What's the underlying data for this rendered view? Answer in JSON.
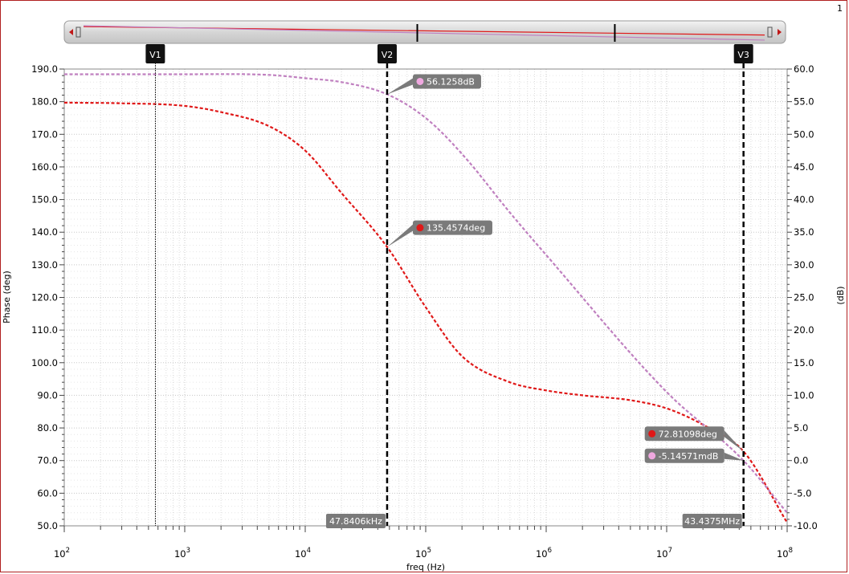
{
  "page_number": "1",
  "chart_data": {
    "type": "line",
    "xlabel": "freq (Hz)",
    "ylabel_left": "Phase (deg)",
    "ylabel_right": "(dB)",
    "x_scale": "log",
    "xlim": [
      100,
      100000000
    ],
    "x_ticks": [
      {
        "value": 100,
        "base": "10",
        "exp": "2"
      },
      {
        "value": 1000,
        "base": "10",
        "exp": "3"
      },
      {
        "value": 10000,
        "base": "10",
        "exp": "4"
      },
      {
        "value": 100000,
        "base": "10",
        "exp": "5"
      },
      {
        "value": 1000000,
        "base": "10",
        "exp": "6"
      },
      {
        "value": 10000000,
        "base": "10",
        "exp": "7"
      },
      {
        "value": 100000000,
        "base": "10",
        "exp": "8"
      }
    ],
    "ylim_left": [
      50,
      190
    ],
    "y_ticks_left": [
      "50.0",
      "60.0",
      "70.0",
      "80.0",
      "90.0",
      "100.0",
      "110.0",
      "120.0",
      "130.0",
      "140.0",
      "150.0",
      "160.0",
      "170.0",
      "180.0",
      "190.0"
    ],
    "ylim_right": [
      -10,
      60
    ],
    "y_ticks_right": [
      "-10.0",
      "-5.0",
      "0.0",
      "5.0",
      "10.0",
      "15.0",
      "20.0",
      "25.0",
      "30.0",
      "35.0",
      "40.0",
      "45.0",
      "50.0",
      "55.0",
      "60.0"
    ],
    "grid": true,
    "series": [
      {
        "axis": "left",
        "color": "#e01818",
        "x": [
          100,
          300,
          1000,
          2000,
          5000,
          10000,
          20000,
          47840,
          100000,
          200000,
          500000,
          1000000,
          2000000,
          5000000,
          10000000,
          20000000,
          43440000,
          100000000
        ],
        "y": [
          179.7,
          179.5,
          178.7,
          176.8,
          172.5,
          165.0,
          152.0,
          135.46,
          117.0,
          102.0,
          94.0,
          91.5,
          90.0,
          88.5,
          86.0,
          81.0,
          72.81,
          51.0
        ]
      },
      {
        "axis": "right",
        "color": "#c080c0",
        "x": [
          100,
          1000,
          5000,
          10000,
          20000,
          47840,
          100000,
          200000,
          500000,
          1000000,
          10000000,
          43440000,
          100000000
        ],
        "y": [
          59.2,
          59.2,
          59.1,
          58.6,
          58.0,
          56.13,
          52.5,
          47.0,
          38.0,
          31.5,
          10.5,
          -0.005,
          -8.0
        ]
      }
    ],
    "vertical_markers": [
      {
        "label": "V1",
        "x": 570,
        "style": "thin"
      },
      {
        "label": "V2",
        "x": 47840,
        "style": "bold",
        "readout": "47.8406kHz"
      },
      {
        "label": "V3",
        "x": 43440000,
        "style": "bold",
        "readout": "43.4375MHz"
      }
    ],
    "point_markers": [
      {
        "text": "56.1258dB",
        "x": 47840,
        "y": 56.1258,
        "axis": "right",
        "dot_color": "#f0a8e0"
      },
      {
        "text": "135.4574deg",
        "x": 47840,
        "y": 135.4574,
        "axis": "left",
        "dot_color": "#e01818"
      },
      {
        "text": "72.81098deg",
        "x": 43440000,
        "y": 72.81098,
        "axis": "left",
        "dot_color": "#e01818"
      },
      {
        "text": "-5.14571mdB",
        "x": 43440000,
        "y": -0.00514571,
        "axis": "right",
        "dot_color": "#f0a8e0"
      }
    ],
    "overview": {
      "traces": [
        {
          "color": "#e01818",
          "y_start": 0.85,
          "y_end": 0.35
        },
        {
          "color": "#c080c0",
          "y_start": 0.9,
          "y_end": 0.05
        }
      ],
      "cursor_fractions": [
        0.49,
        0.78
      ]
    }
  }
}
